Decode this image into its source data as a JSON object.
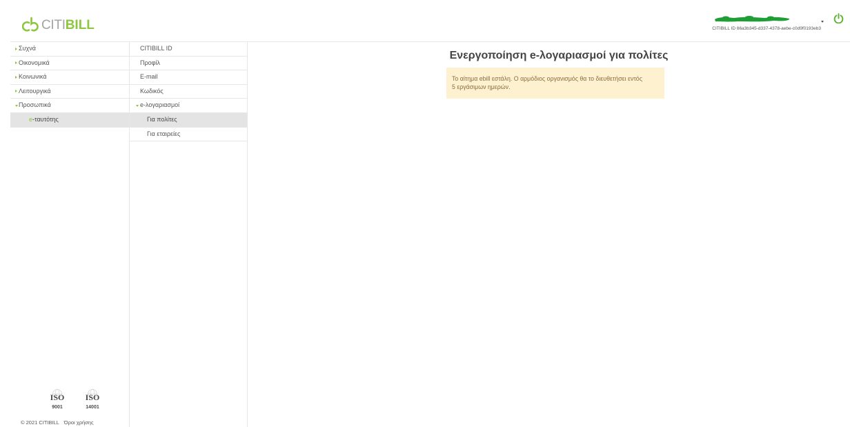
{
  "header": {
    "logo": {
      "light": "CITI",
      "bold": "BILL",
      "icon": "citibill-logo-icon"
    },
    "account": {
      "citibill_id_label": "CITIBILL ID",
      "citibill_id_value": "66a3b345-d337-4378-aebe-c0d9f0193eb3",
      "menu_icon": "chevron-down-icon",
      "logout_icon": "power-icon"
    }
  },
  "nav": {
    "items": [
      {
        "label": "Συχνά",
        "icon": "chevron-right-icon"
      },
      {
        "label": "Οικονομικά",
        "icon": "chevron-right-icon"
      },
      {
        "label": "Κοινωνικά",
        "icon": "chevron-right-icon"
      },
      {
        "label": "Λειτουργικά",
        "icon": "chevron-right-icon"
      },
      {
        "label": "Προσωπικά",
        "icon": "chevron-down-icon",
        "expanded": true
      },
      {
        "label": "e-ταυτότης",
        "selected": true
      }
    ]
  },
  "subnav": {
    "items": [
      {
        "label": "CITIBILL ID"
      },
      {
        "label": "Προφίλ"
      },
      {
        "label": "E-mail"
      },
      {
        "label": "Κωδικός"
      },
      {
        "label": "e-λογαριασμοί",
        "icon": "chevron-down-icon",
        "expanded": true
      },
      {
        "label": "Για πολίτες",
        "selected": true
      },
      {
        "label": "Για εταιρείες"
      }
    ]
  },
  "main": {
    "title": "Ενεργοποίηση e-λογαριασμοί για πολίτες",
    "alert": {
      "lines": [
        "Το αίτημα ebill εστάλη. Ο αρμόδιος οργανισμός θα το διευθετήσει εντός",
        "5 εργάσιμων ημερών."
      ]
    }
  },
  "footer": {
    "certifications": [
      {
        "label": "ISO",
        "number": "9001"
      },
      {
        "label": "ISO",
        "number": "14001"
      }
    ],
    "copyright": "© 2021 CITIBILL",
    "terms_link": "Όροι χρήσης"
  },
  "colors": {
    "accent": "#8dc63f",
    "power": "#5db432",
    "redaction": "#1f9e36",
    "alert_bg": "#fdf1d0",
    "alert_text": "#8a6d3b",
    "selected_bg": "#e4e4e4"
  }
}
